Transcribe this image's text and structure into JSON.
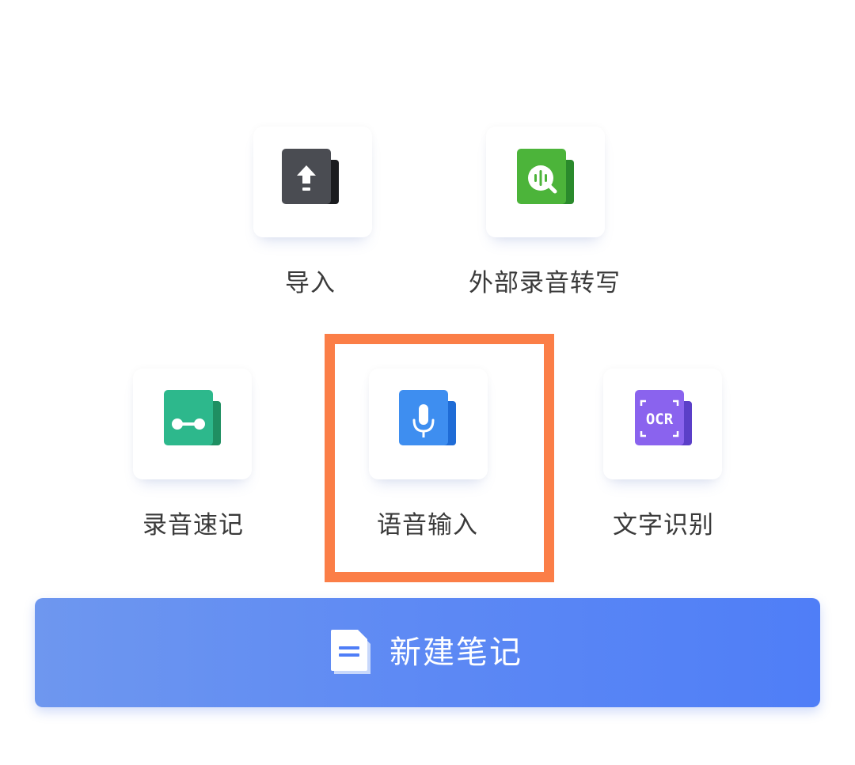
{
  "actions": [
    {
      "id": "import",
      "label": "导入",
      "icon": "upload-icon",
      "color": "#4a4c52",
      "highlighted": false
    },
    {
      "id": "external-transcribe",
      "label": "外部录音转写",
      "icon": "audio-search-icon",
      "color": "#4cb43a",
      "highlighted": false
    },
    {
      "id": "record-shorthand",
      "label": "录音速记",
      "icon": "tape-icon",
      "color": "#2db88c",
      "highlighted": false
    },
    {
      "id": "voice-input",
      "label": "语音输入",
      "icon": "microphone-icon",
      "color": "#3e8ef0",
      "highlighted": true
    },
    {
      "id": "ocr",
      "label": "文字识别",
      "icon": "ocr-icon",
      "icon_text": "OCR",
      "color": "#8a63ee",
      "highlighted": false
    }
  ],
  "highlight_color": "#fb7e47",
  "new_note_button": {
    "label": "新建笔记",
    "icon": "document-icon",
    "color": "#5b88f5"
  }
}
